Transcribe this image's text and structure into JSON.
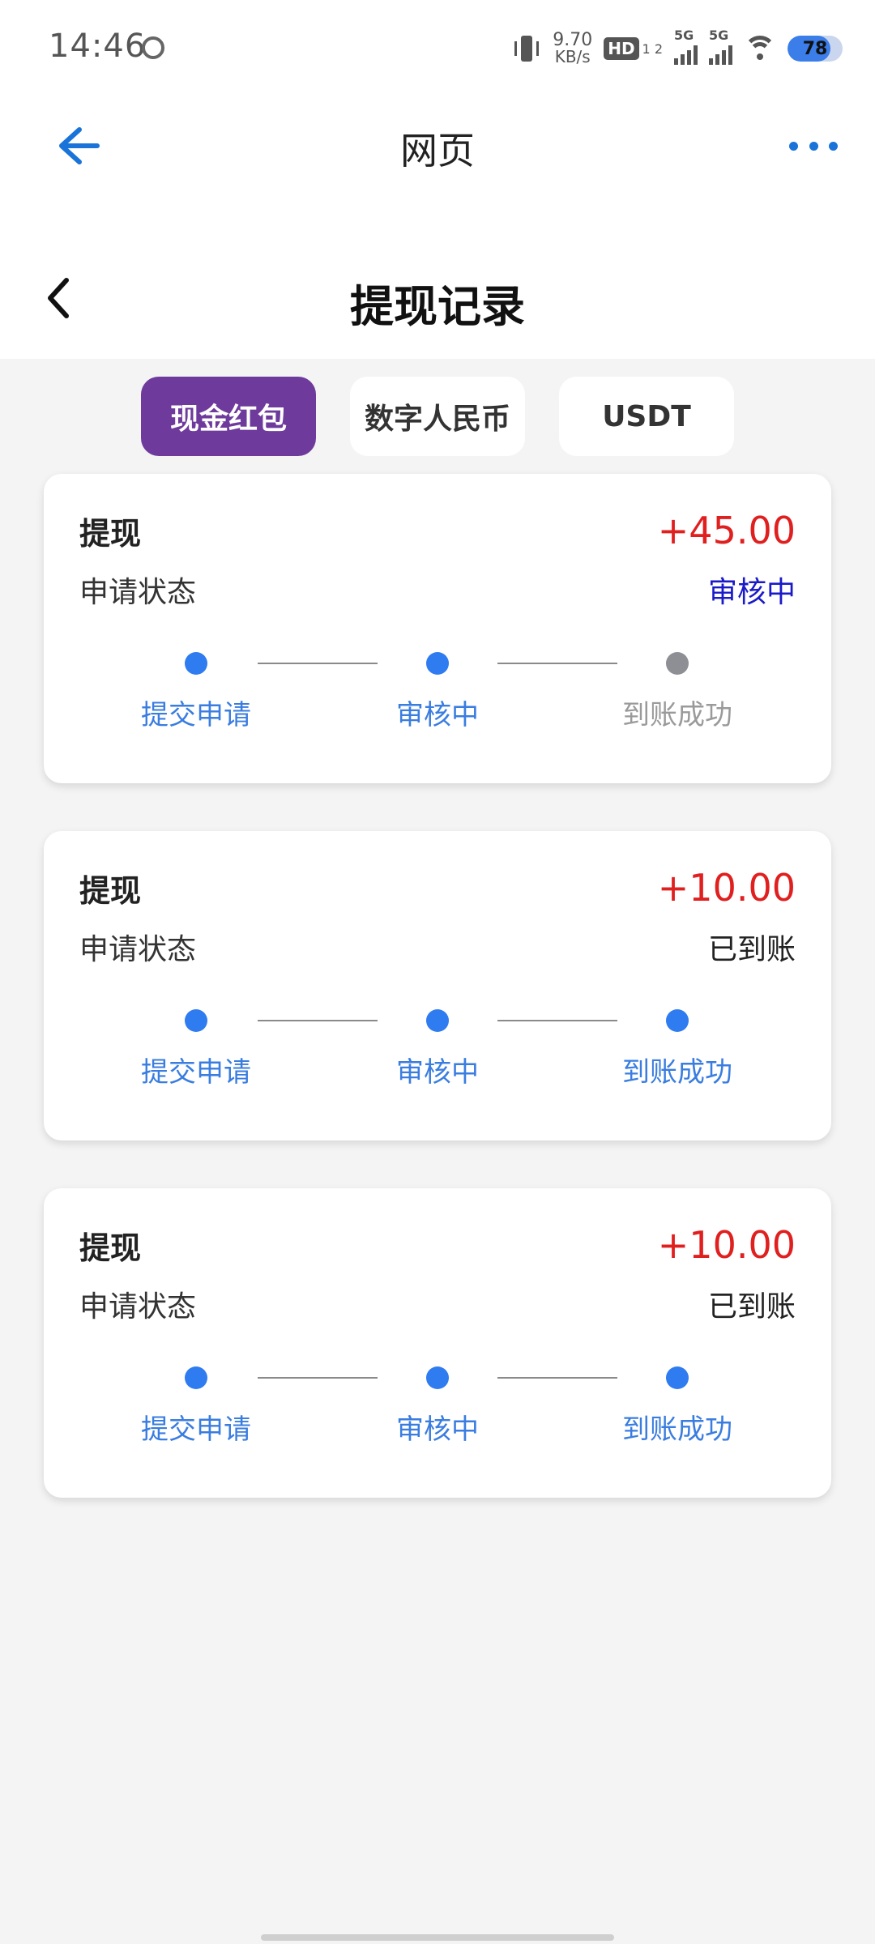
{
  "status_bar": {
    "time": "14:46",
    "net_speed_value": "9.70",
    "net_speed_unit": "KB/s",
    "hd_label": "HD",
    "hd_sub": "1 2",
    "sig1_label": "5G",
    "sig2_label": "5G",
    "battery": "78",
    "battery_level": 0.78
  },
  "nav": {
    "title": "网页"
  },
  "page": {
    "title": "提现记录"
  },
  "tabs": [
    {
      "label": "现金红包",
      "active": true
    },
    {
      "label": "数字人民币",
      "active": false
    },
    {
      "label": "USDT",
      "active": false
    }
  ],
  "colors": {
    "active_tab": "#6e3a9c",
    "amount": "#e01f1f",
    "status_pending": "#1a1ac8",
    "status_done": "#222222",
    "step_active": "#2f7bf0",
    "step_inactive": "#8e8f94"
  },
  "records": [
    {
      "kind": "提现",
      "amount": "+45.00",
      "status_label": "申请状态",
      "status": "审核中",
      "status_type": "pending",
      "steps": [
        {
          "label": "提交申请",
          "done": true
        },
        {
          "label": "审核中",
          "done": true
        },
        {
          "label": "到账成功",
          "done": false
        }
      ]
    },
    {
      "kind": "提现",
      "amount": "+10.00",
      "status_label": "申请状态",
      "status": "已到账",
      "status_type": "done",
      "steps": [
        {
          "label": "提交申请",
          "done": true
        },
        {
          "label": "审核中",
          "done": true
        },
        {
          "label": "到账成功",
          "done": true
        }
      ]
    },
    {
      "kind": "提现",
      "amount": "+10.00",
      "status_label": "申请状态",
      "status": "已到账",
      "status_type": "done",
      "steps": [
        {
          "label": "提交申请",
          "done": true
        },
        {
          "label": "审核中",
          "done": true
        },
        {
          "label": "到账成功",
          "done": true
        }
      ]
    }
  ]
}
